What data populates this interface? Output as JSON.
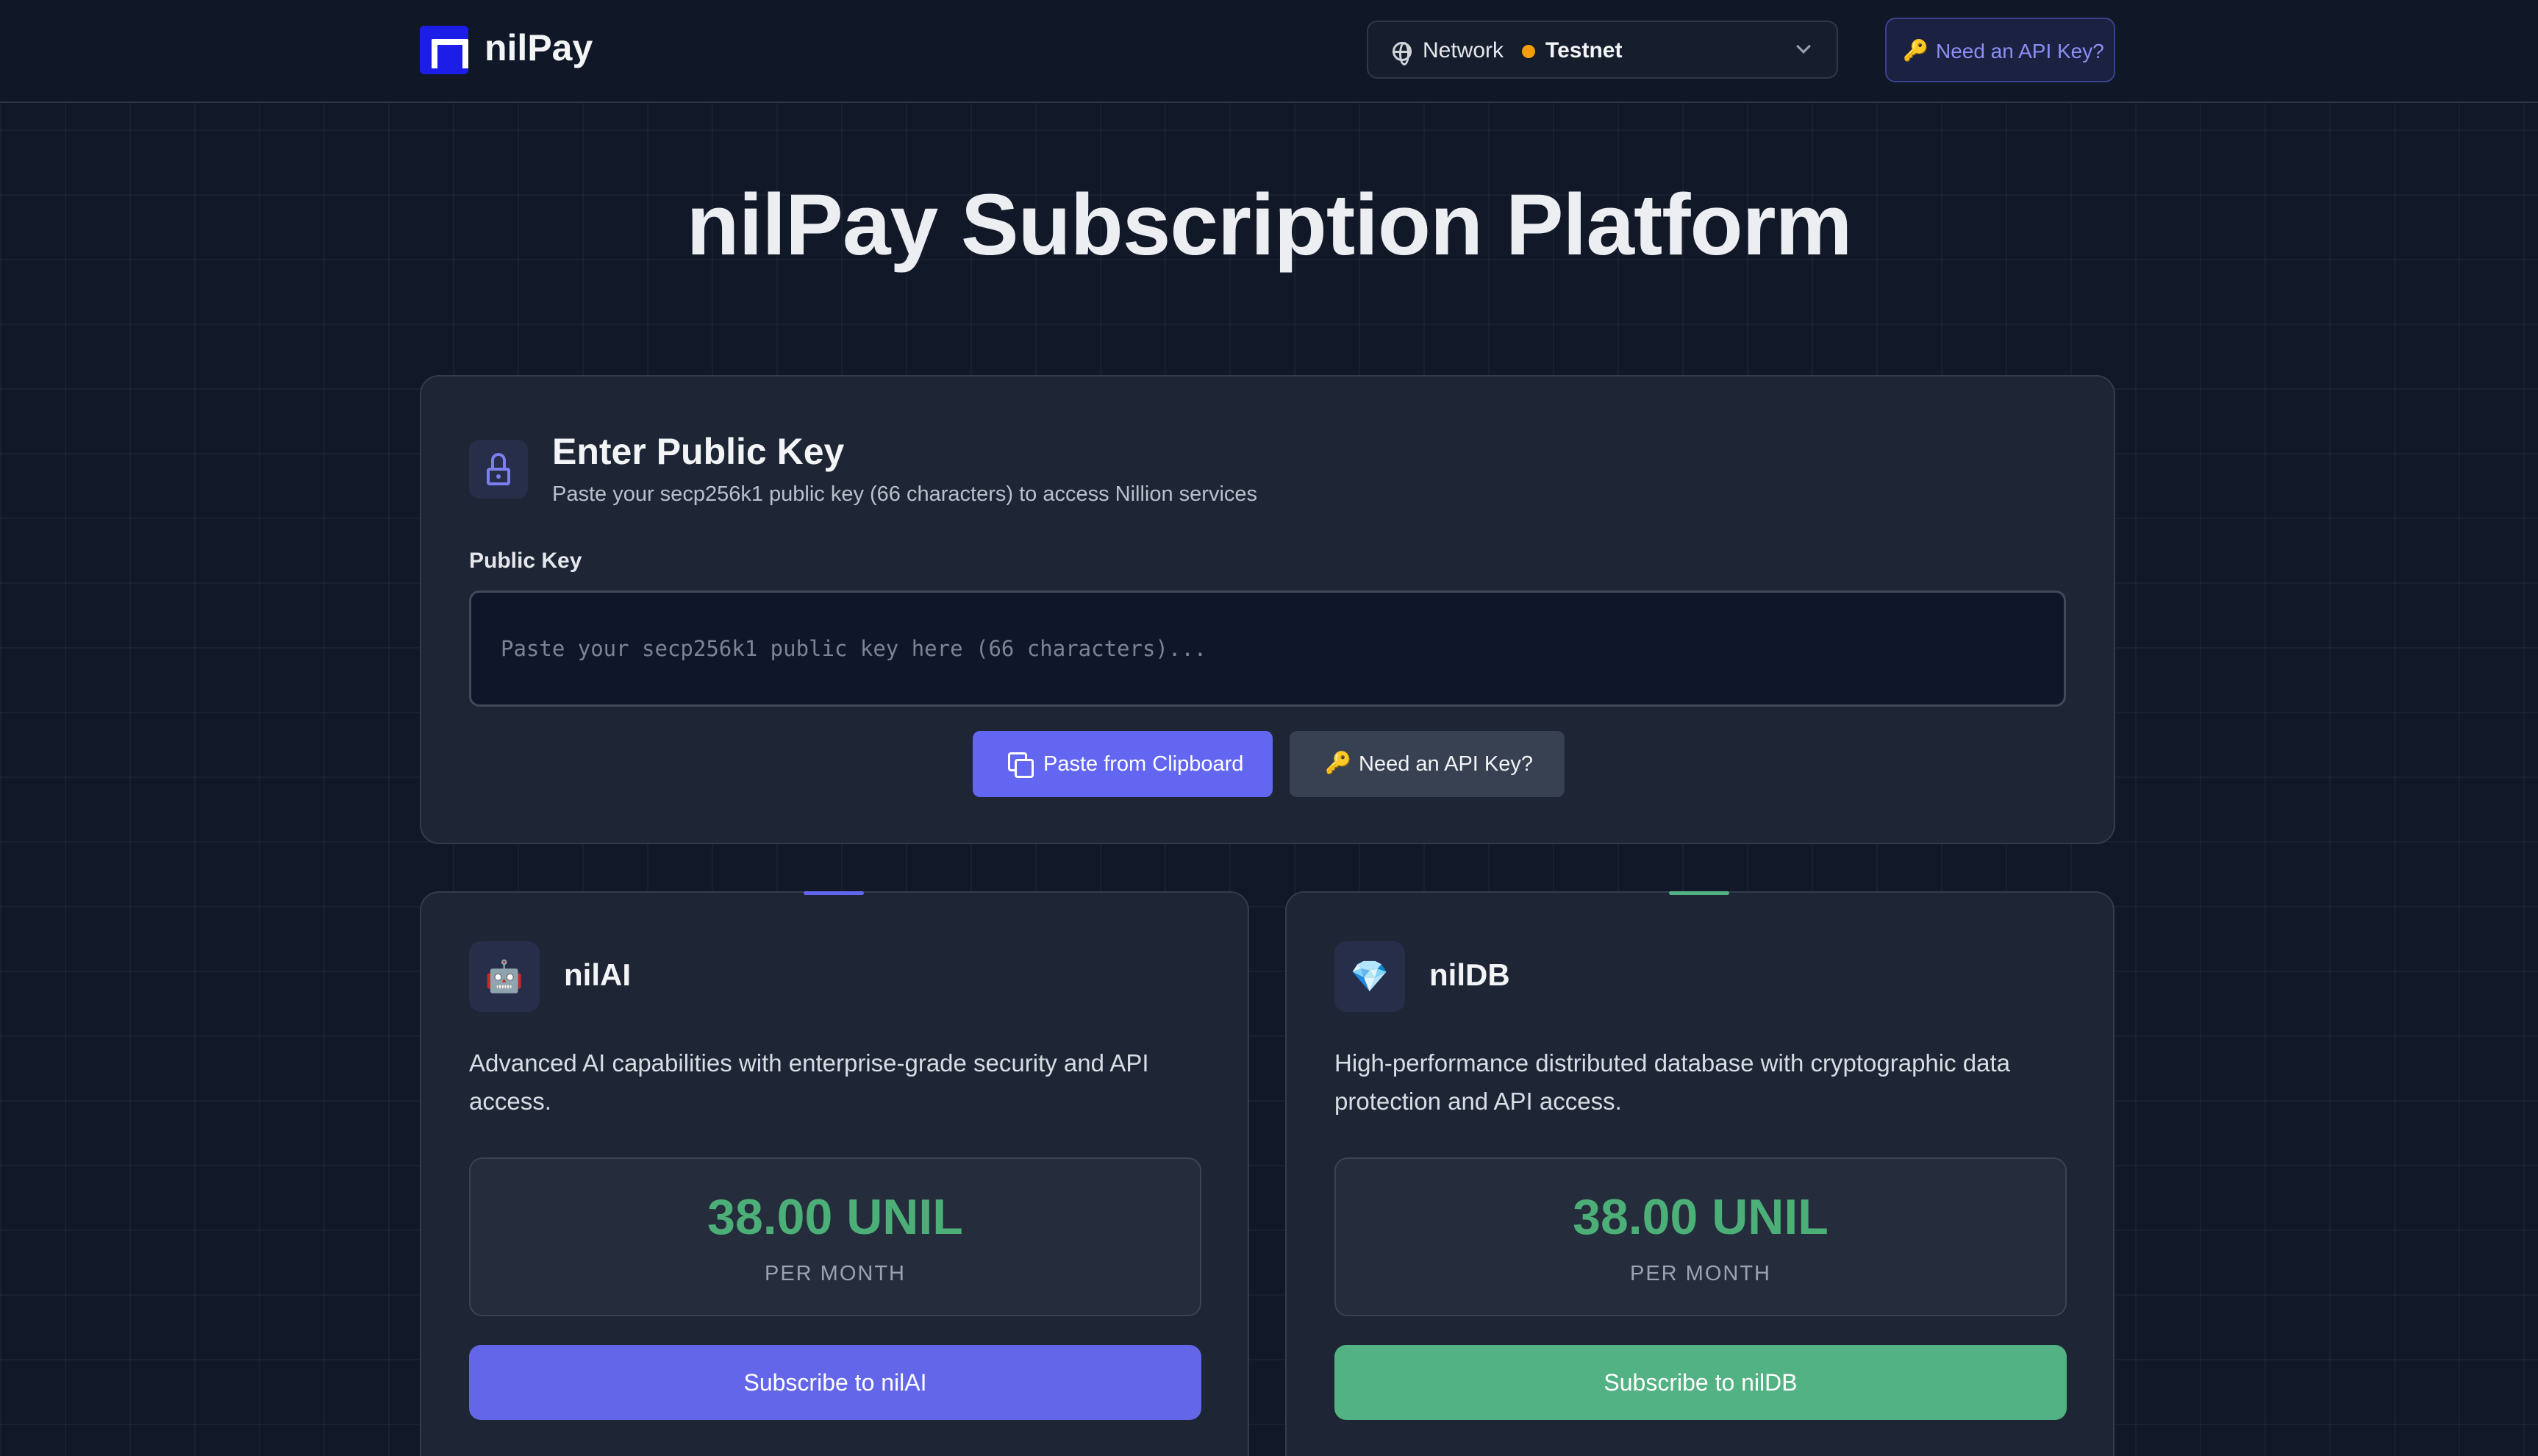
{
  "header": {
    "brand": "nilPay",
    "network_label": "Network",
    "network_value": "Testnet",
    "network_status_color": "#f59e0b",
    "api_key_button": "Need an API Key?",
    "api_key_icon": "🔑"
  },
  "page_title": "nilPay Subscription Platform",
  "public_key_card": {
    "title": "Enter Public Key",
    "subtitle": "Paste your secp256k1 public key (66 characters) to access Nillion services",
    "field_label": "Public Key",
    "placeholder": "Paste your secp256k1 public key here (66 characters)...",
    "paste_button": "Paste from Clipboard",
    "api_key_button": "Need an API Key?",
    "api_key_icon": "🔑"
  },
  "services": [
    {
      "name": "nilAI",
      "icon": "🤖",
      "description": "Advanced AI capabilities with enterprise-grade security and API access.",
      "price": "38.00 UNIL",
      "period": "PER MONTH",
      "button": "Subscribe to nilAI",
      "accent_color": "#6366f1"
    },
    {
      "name": "nilDB",
      "icon": "💎",
      "description": "High-performance distributed database with cryptographic data protection and API access.",
      "price": "38.00 UNIL",
      "period": "PER MONTH",
      "button": "Subscribe to nilDB",
      "accent_color": "#52b283"
    }
  ],
  "colors": {
    "background": "#111827",
    "primary": "#6366f1",
    "success": "#52b283",
    "price": "#4caf78"
  }
}
